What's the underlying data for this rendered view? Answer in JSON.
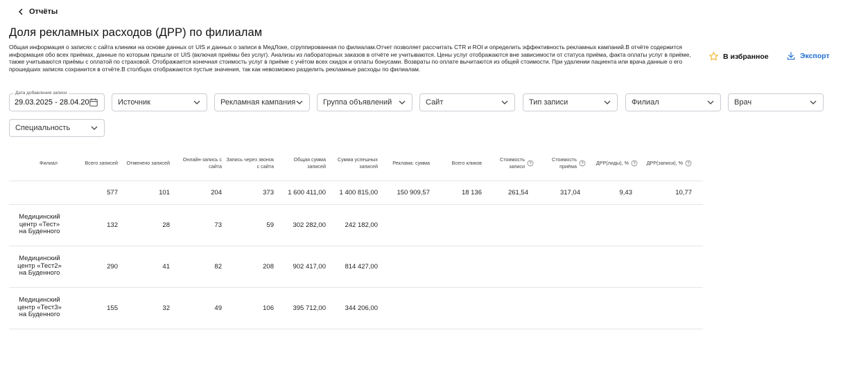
{
  "nav": {
    "back_label": "Отчёты"
  },
  "page": {
    "title": "Доля рекламных расходов (ДРР) по филиалам",
    "description": "Общая информация о записях с сайта клиники на основе данных от UIS и данных о записи в МедЛоке, сгруппированная по филиалам.Отчет позволяет рассчитать CTR и ROI и определить эффективность рекламных кампаний.В отчёте содержится информация обо всех приёмах, данные по которым пришли от UIS (включая приёмы без услуг). Анализы из лабораторных заказов в отчёте не учитываются. Цены услуг отображаются вне зависимости от статуса приёма, факта оплаты услуг в приёме, также учитываются приёмы с оплатой по страховой. Отображается конечная стоимость услуг в приёме с учётом всех скидок и оплаты бонусами. Возвраты по оплате вычитаются из общей стоимости. При удалении пациента или врача данные о его прошедших записях сохранится в отчёте.В столбцах отображаются пустые значения, так как невозможно разделить рекламные  расходы по филиалам."
  },
  "actions": {
    "favorite_label": "В избранное",
    "export_label": "Экспорт",
    "accent_color": "#1f6fd1",
    "star_color": "#f0b429"
  },
  "filters": {
    "date": {
      "legend": "Дата добавления записи",
      "value": "29.03.2025 - 28.04.2025"
    },
    "source": "Источник",
    "campaign": "Рекламная кампания",
    "ad_group": "Группа объявлений",
    "site": "Сайт",
    "record_type": "Тип записи",
    "branch": "Филиал",
    "doctor": "Врач",
    "specialty": "Специальность"
  },
  "table": {
    "headers": {
      "branch": "Филиал",
      "total_records": "Всего записей",
      "cancelled": "Отменено записей",
      "online": "Онлайн-запись с сайта",
      "call": "Запись через звонок с сайта",
      "sum_total": "Общая сумма записей",
      "sum_success": "Сумма успешных записей",
      "ad_sum": "Реклама: сумма",
      "clicks": "Всего кликов",
      "cost_record": "Стоимость записи",
      "cost_visit": "Стоимость приёма",
      "drr_leads": "ДРР(лиды), %",
      "drr_records": "ДРР(записи), %"
    },
    "total": {
      "total_records": "577",
      "cancelled": "101",
      "online": "204",
      "call": "373",
      "sum_total": "1 600 411,00",
      "sum_success": "1 400 815,00",
      "ad_sum": "150 909,57",
      "clicks": "18 136",
      "cost_record": "261,54",
      "cost_visit": "317,04",
      "drr_leads": "9,43",
      "drr_records": "10,77"
    },
    "rows": [
      {
        "branch_l1": "Медицинский",
        "branch_l2": "центр «Тест»",
        "branch_l3": "на Буденного",
        "total_records": "132",
        "cancelled": "28",
        "online": "73",
        "call": "59",
        "sum_total": "302 282,00",
        "sum_success": "242 182,00"
      },
      {
        "branch_l1": "Медицинский",
        "branch_l2": "центр «Тест2»",
        "branch_l3": "на Буденного",
        "total_records": "290",
        "cancelled": "41",
        "online": "82",
        "call": "208",
        "sum_total": "902 417,00",
        "sum_success": "814 427,00"
      },
      {
        "branch_l1": "Медицинский",
        "branch_l2": "центр «Тест3»",
        "branch_l3": "на Буденного",
        "total_records": "155",
        "cancelled": "32",
        "online": "49",
        "call": "106",
        "sum_total": "395 712,00",
        "sum_success": "344 206,00"
      }
    ]
  }
}
